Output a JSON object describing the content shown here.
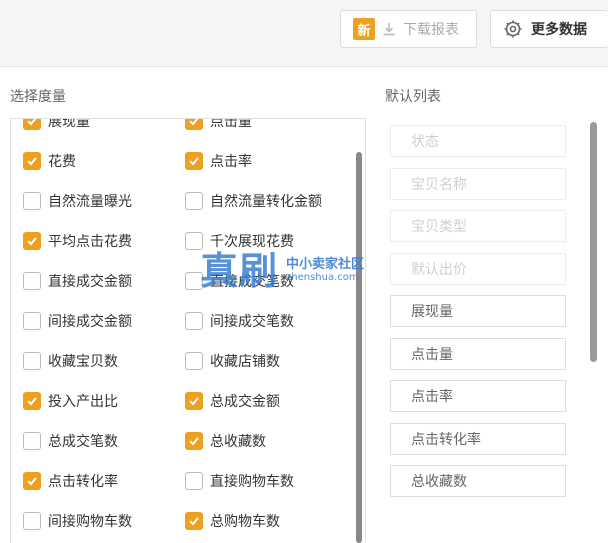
{
  "toolbar": {
    "new_badge": "新",
    "download_label": "下载报表",
    "more_data_label": "更多数据"
  },
  "left_section": {
    "title": "选择度量",
    "options": [
      {
        "label": "展现量",
        "checked": true
      },
      {
        "label": "点击量",
        "checked": true
      },
      {
        "label": "花费",
        "checked": true
      },
      {
        "label": "点击率",
        "checked": true
      },
      {
        "label": "自然流量曝光",
        "checked": false
      },
      {
        "label": "自然流量转化金额",
        "checked": false
      },
      {
        "label": "平均点击花费",
        "checked": true
      },
      {
        "label": "千次展现花费",
        "checked": false
      },
      {
        "label": "直接成交金额",
        "checked": false
      },
      {
        "label": "直接成交笔数",
        "checked": false
      },
      {
        "label": "间接成交金额",
        "checked": false
      },
      {
        "label": "间接成交笔数",
        "checked": false
      },
      {
        "label": "收藏宝贝数",
        "checked": false
      },
      {
        "label": "收藏店铺数",
        "checked": false
      },
      {
        "label": "投入产出比",
        "checked": true
      },
      {
        "label": "总成交金额",
        "checked": true
      },
      {
        "label": "总成交笔数",
        "checked": false
      },
      {
        "label": "总收藏数",
        "checked": true
      },
      {
        "label": "点击转化率",
        "checked": true
      },
      {
        "label": "直接购物车数",
        "checked": false
      },
      {
        "label": "间接购物车数",
        "checked": false
      },
      {
        "label": "总购物车数",
        "checked": true
      }
    ]
  },
  "right_section": {
    "title": "默认列表",
    "items": [
      {
        "label": "状态",
        "disabled": true
      },
      {
        "label": "宝贝名称",
        "disabled": true
      },
      {
        "label": "宝贝类型",
        "disabled": true
      },
      {
        "label": "默认出价",
        "disabled": true
      },
      {
        "label": "展现量",
        "disabled": false
      },
      {
        "label": "点击量",
        "disabled": false
      },
      {
        "label": "点击率",
        "disabled": false
      },
      {
        "label": "点击转化率",
        "disabled": false
      },
      {
        "label": "总收藏数",
        "disabled": false
      }
    ]
  },
  "watermark": {
    "big": "真刷",
    "cn": "中小卖家社区",
    "en": "zhenshua.com"
  },
  "colors": {
    "accent": "#f0a020",
    "watermark": "#3b7fd0"
  }
}
